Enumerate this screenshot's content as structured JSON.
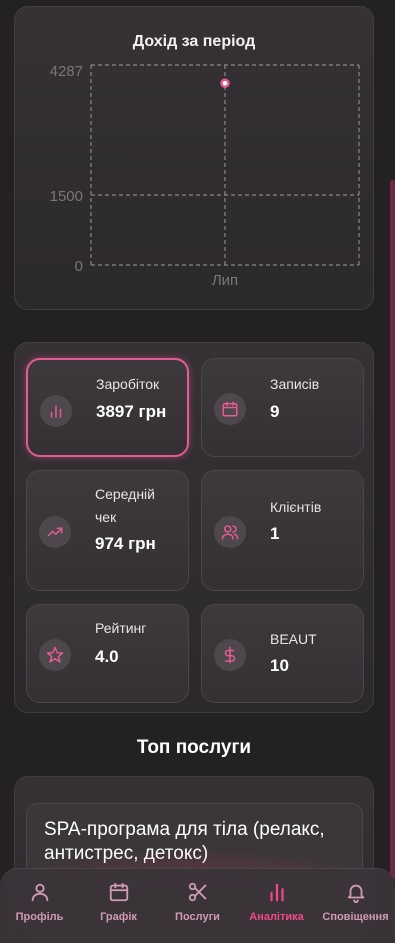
{
  "colors": {
    "accent": "#e55b95",
    "active_nav": "#f2478a",
    "nav_label": "#d09ab3",
    "background": "#242124"
  },
  "chart": {
    "title": "Дохід за період",
    "y_ticks": [
      "4287",
      "1500",
      "0"
    ],
    "x_ticks": [
      "Лип"
    ]
  },
  "chart_data": {
    "type": "line",
    "title": "Дохід за період",
    "categories": [
      "Лип"
    ],
    "series": [
      {
        "values": [
          3897
        ]
      }
    ],
    "yticks": [
      0,
      1500,
      4287
    ],
    "ylim": [
      0,
      4287
    ],
    "grid": true
  },
  "stats": [
    {
      "label": "Заробіток",
      "value": "3897 грн",
      "icon": "bar-chart-icon"
    },
    {
      "label": "Записів",
      "value": "9",
      "icon": "calendar-icon"
    },
    {
      "label": "Середній чек",
      "value": "974 грн",
      "icon": "trending-up-icon"
    },
    {
      "label": "Клієнтів",
      "value": "1",
      "icon": "users-icon"
    },
    {
      "label": "Рейтинг",
      "value": "4.0",
      "icon": "star-icon"
    },
    {
      "label": "BEAUT",
      "value": "10",
      "icon": "dollar-icon"
    }
  ],
  "top_services": {
    "title": "Топ послуги",
    "items": [
      {
        "name": "SPA-програма для тіла (релакс, антистрес, детокс)"
      }
    ]
  },
  "nav": [
    {
      "label": "Профіль",
      "icon": "user-icon"
    },
    {
      "label": "Графік",
      "icon": "calendar-icon"
    },
    {
      "label": "Послуги",
      "icon": "scissors-icon"
    },
    {
      "label": "Аналітика",
      "icon": "bar-chart-icon",
      "active": true
    },
    {
      "label": "Сповіщення",
      "icon": "bell-icon"
    }
  ]
}
